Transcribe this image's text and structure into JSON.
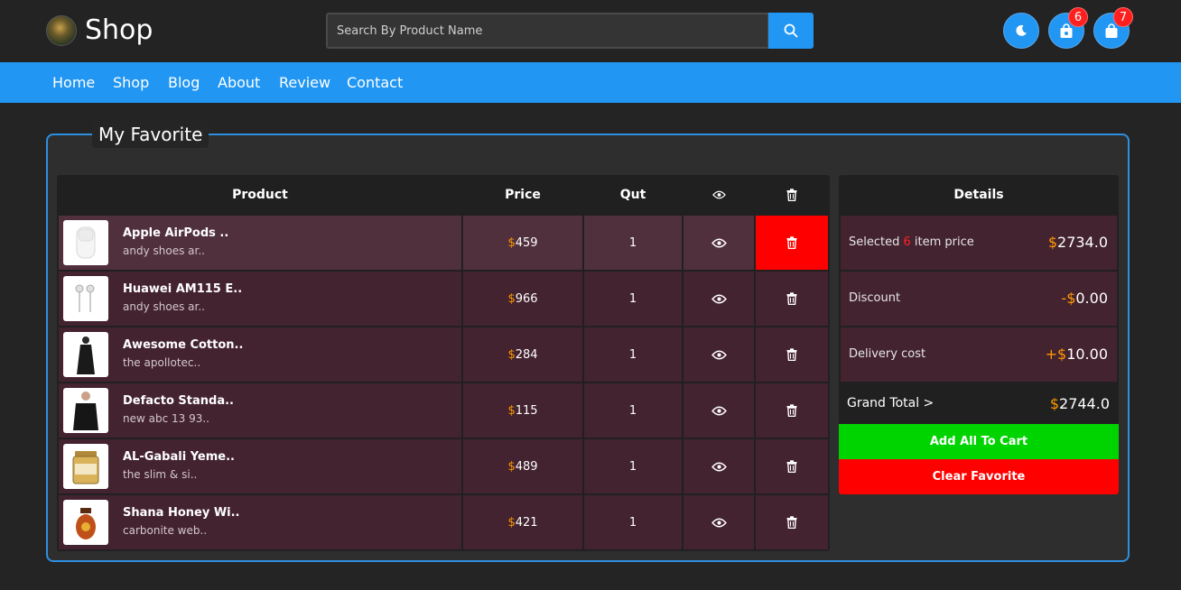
{
  "header": {
    "logo_text": "Shop",
    "search_placeholder": "Search By Product Name",
    "wishlist_count": "6",
    "cart_count": "7"
  },
  "nav": {
    "items": [
      "Home",
      "Shop",
      "Blog",
      "About",
      "Review",
      "Contact"
    ]
  },
  "favorite": {
    "title": "My Favorite",
    "columns": {
      "product": "Product",
      "price": "Price",
      "qty": "Qut"
    },
    "currency_symbol": "$",
    "products": [
      {
        "name": "Apple AirPods ..",
        "desc": "andy shoes ar..",
        "price": "459",
        "qty": "1"
      },
      {
        "name": "Huawei AM115 E..",
        "desc": "andy shoes ar..",
        "price": "966",
        "qty": "1"
      },
      {
        "name": "Awesome Cotton..",
        "desc": "the apollotec..",
        "price": "284",
        "qty": "1"
      },
      {
        "name": "Defacto Standa..",
        "desc": "new abc 13 93..",
        "price": "115",
        "qty": "1"
      },
      {
        "name": "AL-Gabali Yeme..",
        "desc": "the slim & si..",
        "price": "489",
        "qty": "1"
      },
      {
        "name": "Shana Honey Wi..",
        "desc": "carbonite web..",
        "price": "421",
        "qty": "1"
      }
    ]
  },
  "details": {
    "title": "Details",
    "selected_prefix": "Selected ",
    "selected_count": "6",
    "selected_suffix": " item price",
    "selected_value": "2734.0",
    "discount_label": "Discount",
    "discount_sign": "-",
    "discount_value": "0.00",
    "delivery_label": "Delivery cost",
    "delivery_sign": "+",
    "delivery_value": "10.00",
    "grand_total_label": "Grand Total >",
    "grand_total_value": "2744.0",
    "add_all_label": "Add All To Cart",
    "clear_label": "Clear Favorite"
  },
  "colors": {
    "accent": "#2196f3",
    "row_bg": "#442330",
    "row_highlight": "#51303d",
    "delete_active": "#ff0000",
    "add_cart": "#00d400",
    "price_symbol": "#ff9800"
  },
  "icons": [
    "search-icon",
    "moon-icon",
    "bag-icon",
    "shopping-bag-icon",
    "eye-icon",
    "trash-icon"
  ]
}
